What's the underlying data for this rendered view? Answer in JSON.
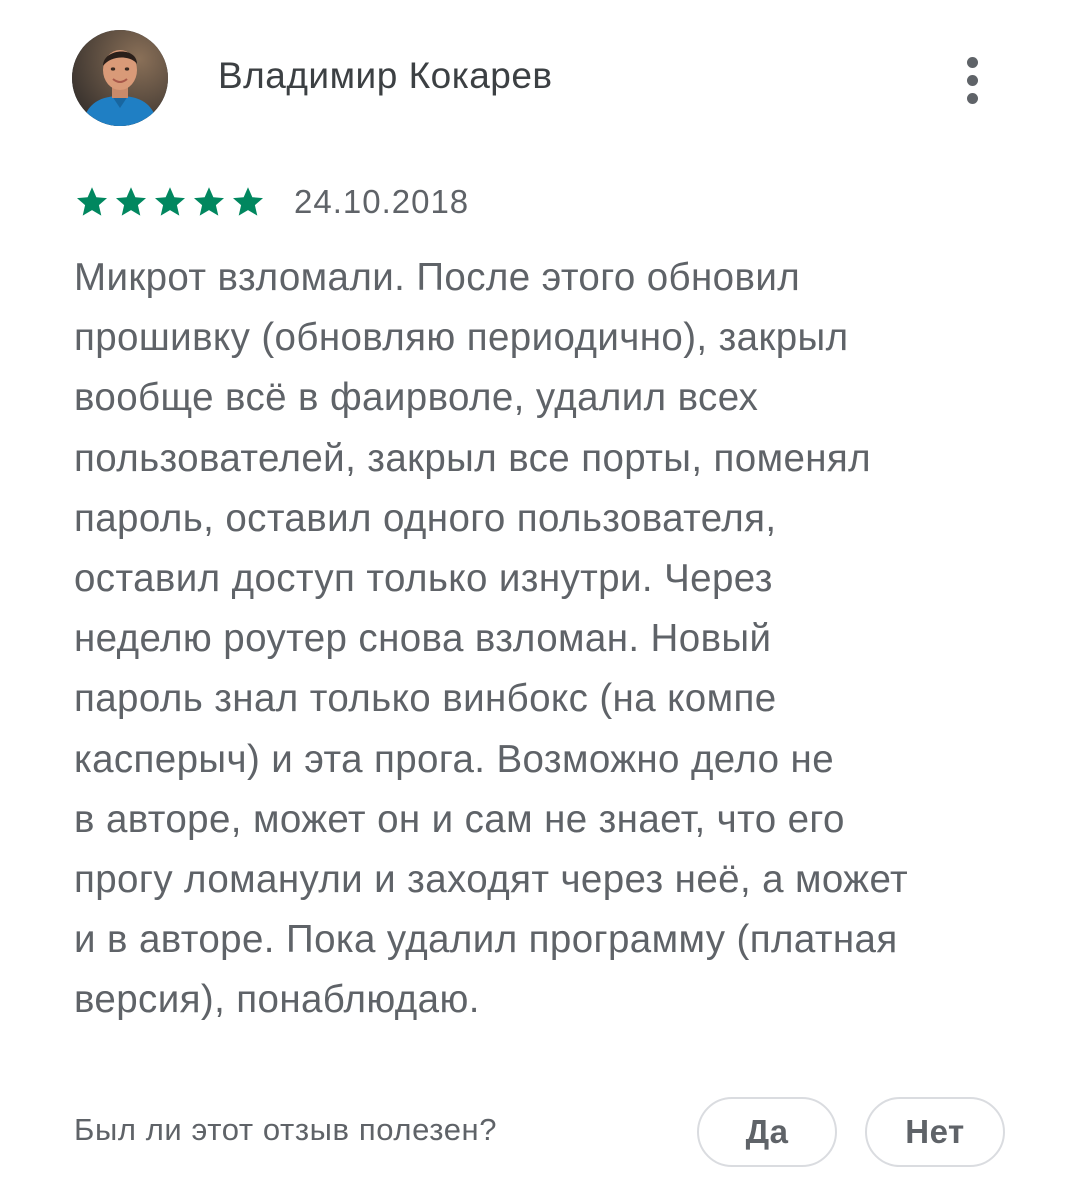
{
  "review": {
    "author": {
      "name": "Владимир Кокарев",
      "avatar": "user-avatar-photo"
    },
    "more_icon": "more-vert-icon",
    "rating": {
      "stars": 5,
      "max": 5,
      "star_color": "#01875f",
      "star_icon": "star-icon"
    },
    "date": "24.10.2018",
    "text_lines": [
      "Микрот взломали. После этого обновил",
      "прошивку (обновляю периодично), закрыл",
      "вообще всё в фаирволе, удалил всех",
      "пользователей, закрыл все порты, поменял",
      "пароль, оставил одного пользователя,",
      "оставил доступ только изнутри. Через",
      "неделю роутер снова взломан. Новый",
      "пароль знал только винбокс (на компе",
      "касперыч) и эта прога. Возможно дело не",
      "в авторе, может он и сам не знает, что его",
      "прогу ломанули и заходят через неё, а может",
      "и в авторе. Пока удалил программу (платная",
      "версия), понаблюдаю."
    ],
    "helpful": {
      "question": "Был ли этот отзыв полезен?",
      "yes_label": "Да",
      "no_label": "Нет"
    }
  }
}
